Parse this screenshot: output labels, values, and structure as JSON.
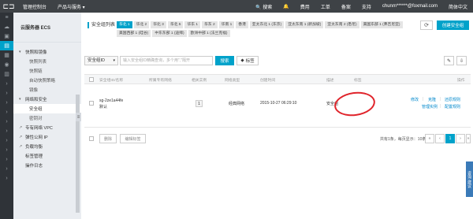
{
  "topbar": {
    "logo_icon": "aliyun-logo-icon",
    "console": "管理控制台",
    "products": "产品与服务 ▾",
    "search": "搜索",
    "fees": "费用",
    "tickets": "工单",
    "beian": "备案",
    "support": "支持",
    "user": "chunm******@foxmail.com",
    "lang": "简体中文"
  },
  "sidebar": {
    "header": "云服务器 ECS",
    "items": [
      {
        "label": "快照和镜像",
        "type": "group"
      },
      {
        "label": "快照列表",
        "type": "item"
      },
      {
        "label": "快照链",
        "type": "item"
      },
      {
        "label": "自动快照策略",
        "type": "item"
      },
      {
        "label": "镜像",
        "type": "item"
      },
      {
        "label": "网络和安全",
        "type": "group"
      },
      {
        "label": "安全组",
        "type": "item",
        "active": true
      },
      {
        "label": "密钥对",
        "type": "item"
      },
      {
        "label": "专有网络 VPC",
        "type": "link"
      },
      {
        "label": "弹性公网 IP",
        "type": "link"
      },
      {
        "label": "负载均衡",
        "type": "link"
      },
      {
        "label": "标签管理",
        "type": "plain"
      },
      {
        "label": "操作日志",
        "type": "plain"
      }
    ]
  },
  "main": {
    "title": "安全组列表",
    "regions": [
      {
        "label": "华北 1",
        "active": true
      },
      {
        "label": "华北 2"
      },
      {
        "label": "华北 3"
      },
      {
        "label": "华北 5"
      },
      {
        "label": "华东 1"
      },
      {
        "label": "华东 2"
      },
      {
        "label": "华南 1"
      },
      {
        "label": "香港"
      },
      {
        "label": "亚太东北 1 (东京)"
      },
      {
        "label": "亚太东南 1 (新加坡)"
      },
      {
        "label": "亚太东南 2 (悉尼)"
      },
      {
        "label": "美国东部 1 (弗吉尼亚)"
      },
      {
        "label": "美国西部 1 (硅谷)"
      },
      {
        "label": "中东东部 1 (迪拜)"
      },
      {
        "label": "欧洲中部 1 (法兰克福)"
      }
    ],
    "refresh_icon": "refresh-icon",
    "create_button": "创建安全组",
    "filter_select": "安全组ID",
    "search_placeholder": "输入安全组ID精确查询，多个用\",\"隔开",
    "search_button": "搜索",
    "tag_button": "标签",
    "columns": [
      "安全组ID/名称",
      "所属专有网络",
      "相关实例",
      "网络类型",
      "创建时间",
      "描述",
      "标签",
      "操作"
    ],
    "row": {
      "id": "sg-2ze1a44fe",
      "name": "默认",
      "instances": "1",
      "network": "经典网络",
      "created": "2015-10-27 06:29:10",
      "desc": "安全组",
      "actions": {
        "edit": "修改",
        "clone": "克隆",
        "restore": "还原规则",
        "manage_instances": "管理实例",
        "config_rules": "配置规则"
      }
    },
    "delete_button": "删除",
    "edit_tag_button": "编辑标签",
    "pager_text": "共有1条，每页显示：10条",
    "pager": {
      "first": "«",
      "prev": "‹",
      "current": "1",
      "next": "›",
      "last": "»"
    }
  },
  "feedback": "咨询·建议"
}
